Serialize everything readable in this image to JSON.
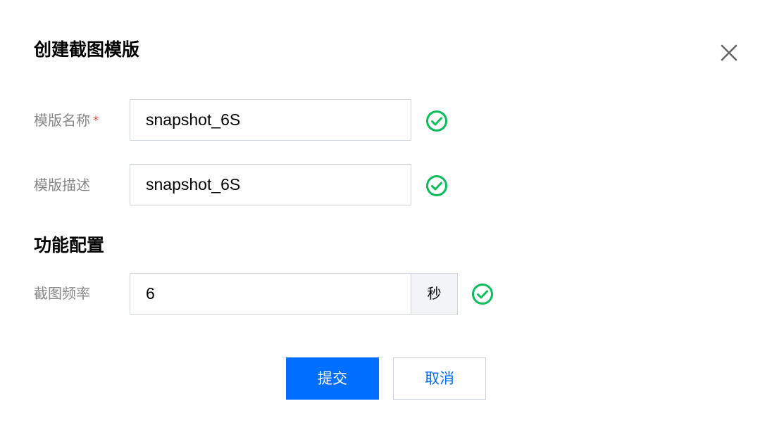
{
  "dialog": {
    "title": "创建截图模版",
    "close_icon": "close-icon"
  },
  "form": {
    "name": {
      "label": "模版名称",
      "required_mark": "*",
      "value": "snapshot_6S",
      "status_icon": "check-circle-icon"
    },
    "description": {
      "label": "模版描述",
      "value": "snapshot_6S",
      "status_icon": "check-circle-icon"
    }
  },
  "section": {
    "title": "功能配置"
  },
  "frequency": {
    "label": "截图频率",
    "value": "6",
    "unit": "秒",
    "status_icon": "check-circle-icon"
  },
  "actions": {
    "submit_label": "提交",
    "cancel_label": "取消"
  },
  "colors": {
    "primary": "#006eff",
    "success": "#0abf5b",
    "required": "#e54545",
    "border": "#cfd5de"
  }
}
